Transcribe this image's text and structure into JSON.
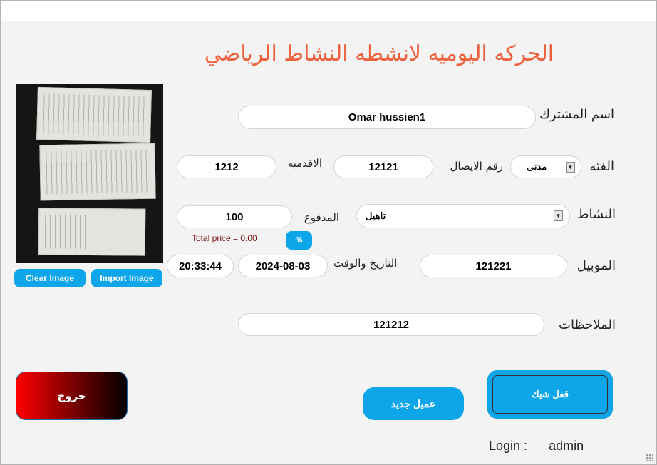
{
  "header": {
    "title": "الحركه اليوميه لانشطه النشاط الرياضي"
  },
  "subscriber": {
    "label": "اسم المشترك",
    "value": "Omar hussien1"
  },
  "category": {
    "label": "الفئه",
    "selected": "مدنى",
    "arrow_icon": "dropdown-arrow-icon"
  },
  "receipt": {
    "label": "رقم الايصال",
    "value": "12121"
  },
  "academy": {
    "label": "الاقدميه",
    "value": "1212"
  },
  "activity": {
    "label": "النشاط",
    "selected": "تاهيل",
    "arrow_icon": "dropdown-arrow-icon"
  },
  "paid": {
    "label": "المدفوع",
    "value": "100",
    "total_text": "Total price = 0.00",
    "percent_label": "%"
  },
  "mobile": {
    "label": "الموبيل",
    "value": "121221"
  },
  "datetime": {
    "label": "التاريخ والوقت",
    "date": "2024-08-03",
    "time": "20:33:44"
  },
  "notes": {
    "label": "الملاحظات",
    "value": "121212"
  },
  "image_buttons": {
    "clear": "Clear Image",
    "import": "Import Image"
  },
  "actions": {
    "exit": "خروج",
    "new_client": "عميل جديد",
    "lock_check": "قفل شيك"
  },
  "login": {
    "label": "Login :",
    "user": "admin"
  },
  "colors": {
    "title": "#ee5f3c",
    "accent": "#0ea5e9",
    "background": "#f3f3f3"
  }
}
